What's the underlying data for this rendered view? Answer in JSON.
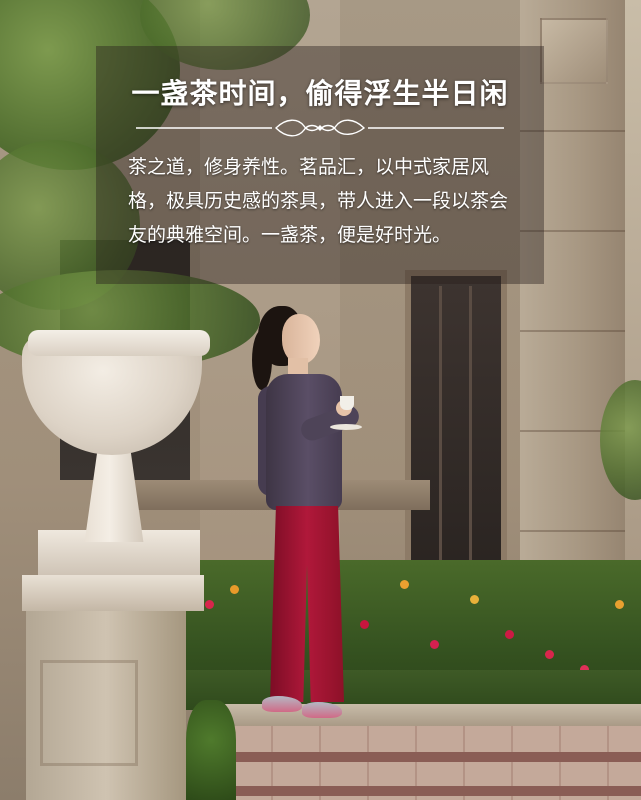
{
  "photo": {
    "headline": "一盏茶时间，偷得浮生半日闲",
    "body": "茶之道，修身养性。茗品汇，以中式家居风格，极具历史感的茶具，带人进入一段以茶会友的典雅空间。一盏茶，便是好时光。",
    "scene_elements": {
      "urn_planter": "stone-urn-planter",
      "woman": "woman-holding-teacup",
      "garden": "flower-garden-bed",
      "building": "stone-building-facade",
      "path": "paved-garden-path"
    },
    "colors": {
      "overlay": "#28201c",
      "text": "#ffffff",
      "pants": "#b0183a",
      "top": "#4e4458",
      "stone": "#a89883"
    }
  }
}
